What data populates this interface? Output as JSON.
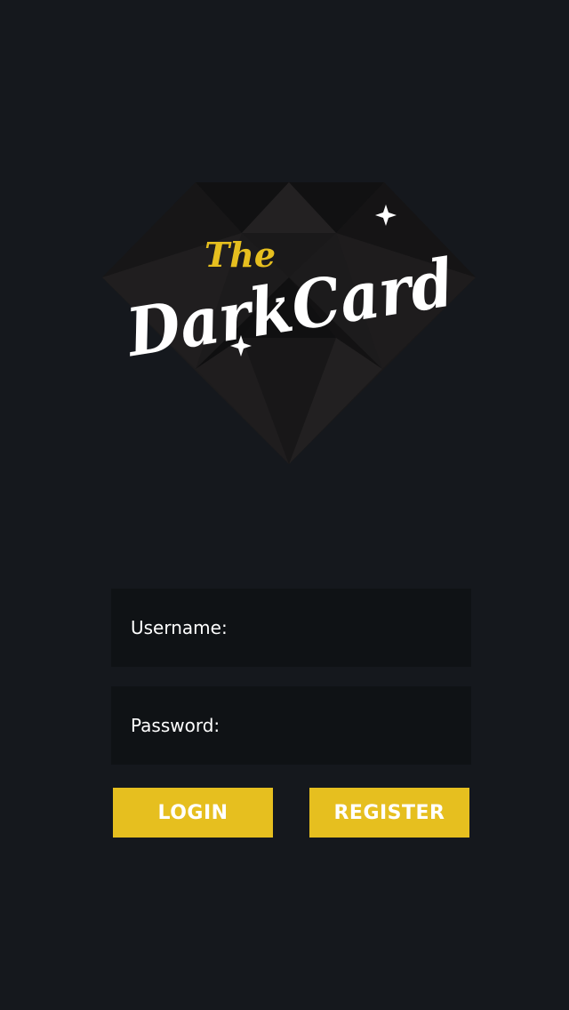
{
  "brand": {
    "the": "The",
    "name": "DarkCard"
  },
  "form": {
    "username_label": "Username:",
    "username_value": "",
    "password_label": "Password:",
    "password_value": ""
  },
  "buttons": {
    "login_label": "LOGIN",
    "register_label": "REGISTER"
  },
  "colors": {
    "background": "#15181d",
    "field_background": "#0f1215",
    "accent": "#e6bf1f",
    "text": "#ffffff"
  },
  "icons": [
    "diamond-logo-icon",
    "sparkle-icon"
  ]
}
